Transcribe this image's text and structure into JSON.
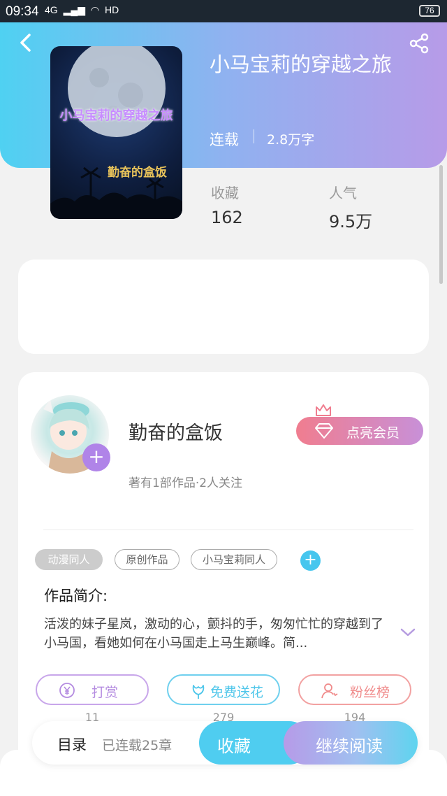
{
  "status_bar": {
    "time": "09:34",
    "network": "4G",
    "hd": "HD",
    "battery": "76"
  },
  "book": {
    "title": "小马宝莉的穿越之旅",
    "status": "连载",
    "word_count": "2.8万字",
    "cover_title": "小马宝莉的穿越之旅",
    "cover_author": "勤奋的盒饭"
  },
  "stats": {
    "favorites_label": "收藏",
    "favorites_value": "162",
    "popularity_label": "人气",
    "popularity_value": "9.5万"
  },
  "author": {
    "name": "勤奋的盒饭",
    "meta": "著有1部作品·2人关注",
    "vip_button": "点亮会员"
  },
  "tags": [
    "动漫同人",
    "原创作品",
    "小马宝莉同人"
  ],
  "intro": {
    "heading": "作品简介:",
    "text": "活泼的妹子星岚，激动的心，颤抖的手，匆匆忙忙的穿越到了小马国，看她如何在小马国走上马生巅峰。简..."
  },
  "actions": [
    {
      "label": "打赏",
      "count": "11",
      "color": "#b48be0"
    },
    {
      "label": "免费送花",
      "count": "279",
      "color": "#4ec6ea"
    },
    {
      "label": "粉丝榜",
      "count": "194",
      "color": "#f08a8a"
    }
  ],
  "bottom": {
    "toc_label": "目录",
    "toc_count": "已连载25章",
    "collect_label": "收藏",
    "read_label": "继续阅读"
  },
  "colors": {
    "header_start": "#4fd1f2",
    "header_end": "#b79be8",
    "accent_blue": "#4fcdf0",
    "accent_purple": "#b084e8"
  },
  "icons": [
    "back-arrow-icon",
    "share-icon",
    "crown-icon",
    "diamond-icon",
    "plus-icon",
    "chevron-down-icon",
    "yen-icon",
    "flower-icon",
    "person-icon"
  ]
}
